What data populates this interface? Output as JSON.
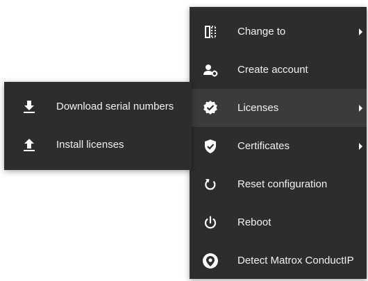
{
  "main_menu": {
    "items": [
      {
        "label": "Change to",
        "icon": "columns-icon",
        "has_submenu": true
      },
      {
        "label": "Create account",
        "icon": "user-gear-icon",
        "has_submenu": false
      },
      {
        "label": "Licenses",
        "icon": "badge-check-icon",
        "has_submenu": true,
        "active": true
      },
      {
        "label": "Certificates",
        "icon": "shield-check-icon",
        "has_submenu": true
      },
      {
        "label": "Reset configuration",
        "icon": "refresh-icon",
        "has_submenu": false
      },
      {
        "label": "Reboot",
        "icon": "power-icon",
        "has_submenu": false
      },
      {
        "label": "Detect Matrox ConductIP",
        "icon": "location-target-icon",
        "has_submenu": false
      }
    ]
  },
  "licenses_submenu": {
    "items": [
      {
        "label": "Download serial numbers",
        "icon": "download-icon"
      },
      {
        "label": "Install licenses",
        "icon": "upload-icon"
      }
    ]
  },
  "colors": {
    "menu_bg": "#2d2d2d",
    "active_bg": "#3b3b3b",
    "text": "#f2f2f2"
  }
}
